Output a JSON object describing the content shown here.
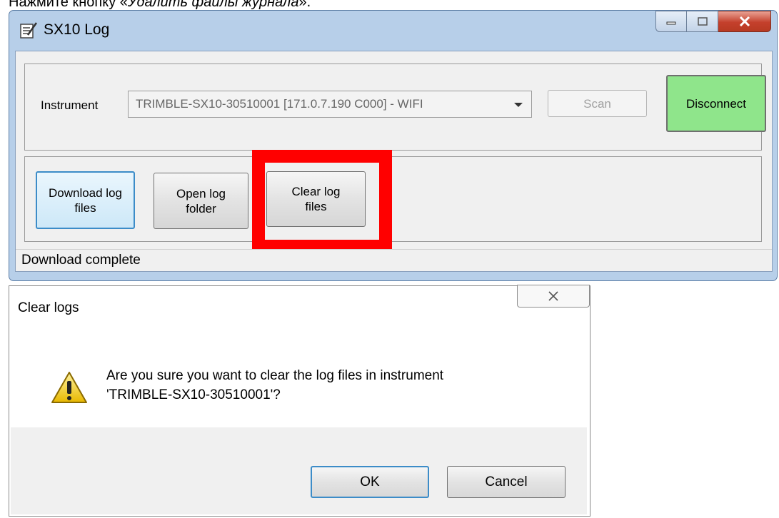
{
  "caption": {
    "prefix": "Нажмите кнопку «",
    "emphasis": "Удалить файлы журнала",
    "suffix": "»."
  },
  "main_window": {
    "title": "SX10 Log",
    "instrument_label": "Instrument",
    "instrument_value": "TRIMBLE-SX10-30510001 [171.0.7.190 C000] - WIFI",
    "scan_label": "Scan",
    "disconnect_label": "Disconnect",
    "download_label": "Download log files",
    "open_folder_label": "Open log folder",
    "clear_label": "Clear log files",
    "status": "Download complete",
    "highlight_color": "#ff0000",
    "disconnect_color": "#8fe58b"
  },
  "dialog": {
    "title": "Clear logs",
    "message_line1": "Are you sure you want to clear the log files in instrument",
    "message_line2": "'TRIMBLE-SX10-30510001'?",
    "ok_label": "OK",
    "cancel_label": "Cancel",
    "icon": "warning-icon"
  }
}
